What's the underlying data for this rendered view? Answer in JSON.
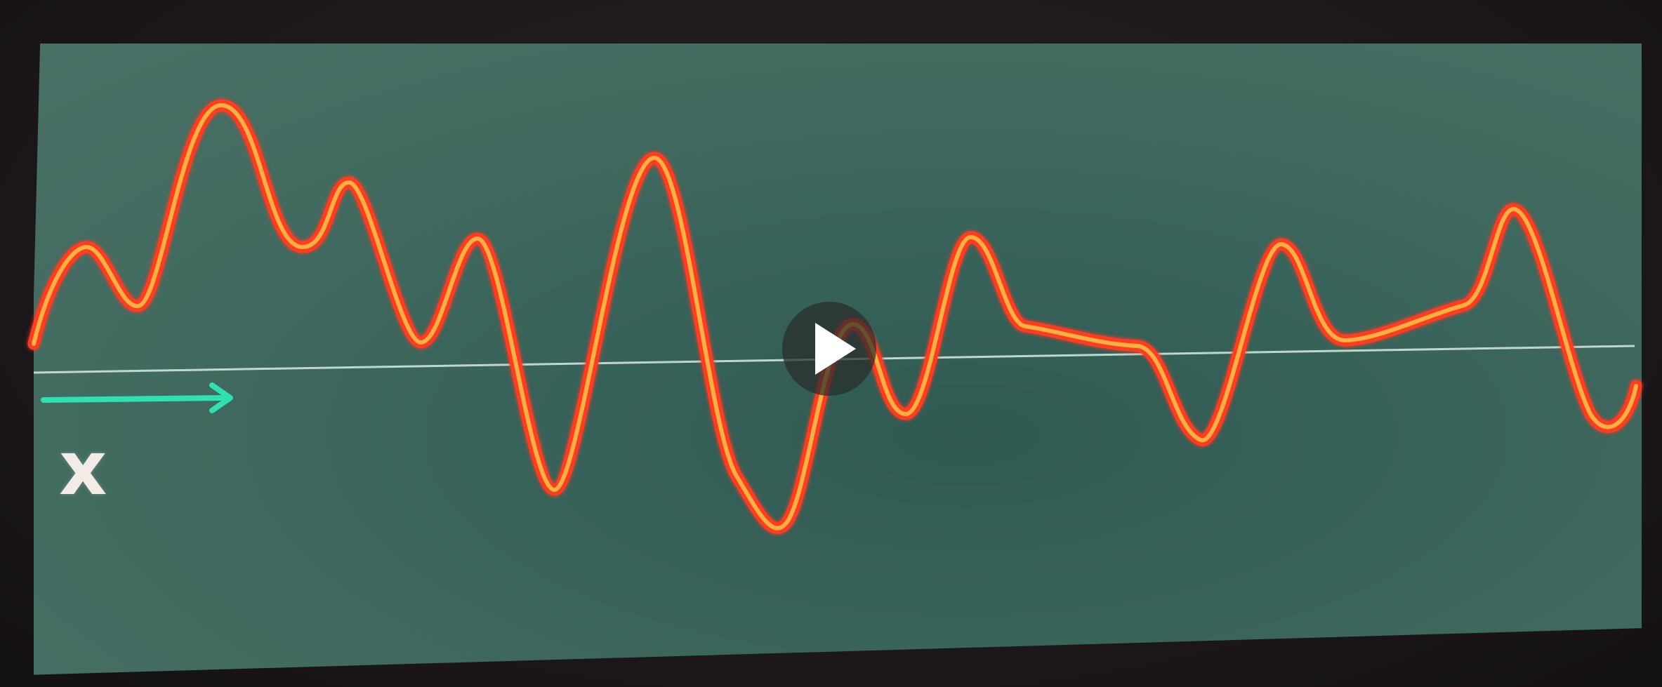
{
  "video": {
    "axis_label": "x",
    "play_icon": "play-icon",
    "arrow_icon": "right-arrow-icon"
  },
  "colors": {
    "background": "#3d665c",
    "wave_outer": "#ff3b20",
    "wave_inner": "#ffb040",
    "baseline": "#cfe3dc",
    "arrow": "#2fe0b0"
  }
}
